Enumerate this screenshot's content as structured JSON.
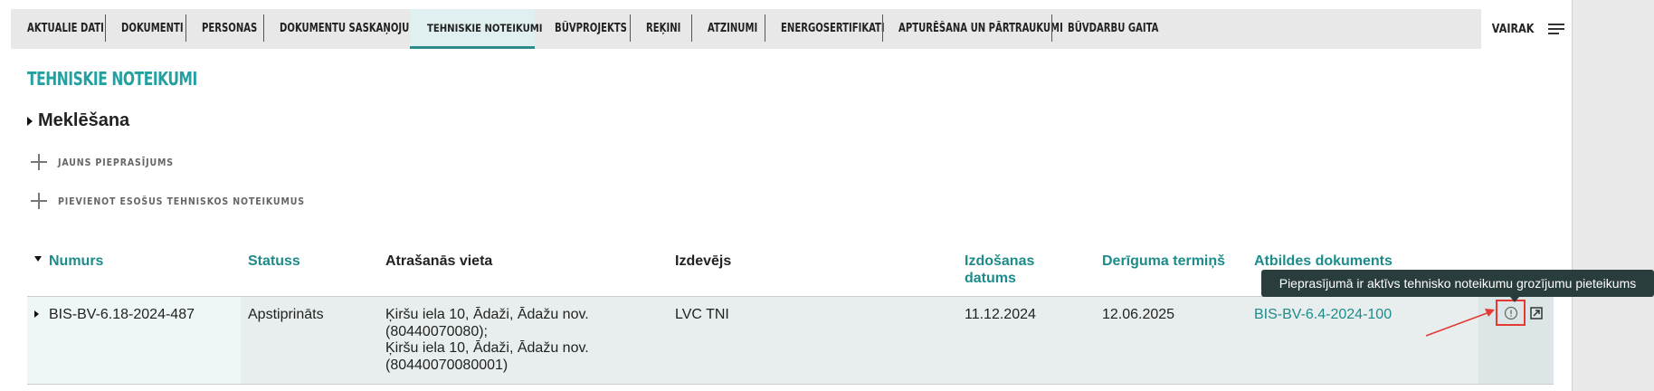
{
  "tabs": [
    {
      "label": "AKTUĀLIE DATI"
    },
    {
      "label": "DOKUMENTI"
    },
    {
      "label": "PERSONAS"
    },
    {
      "label": "DOKUMENTU SASKAŅOJUMI"
    },
    {
      "label": "TEHNISKIE NOTEIKUMI",
      "active": true
    },
    {
      "label": "BŪVPROJEKTS"
    },
    {
      "label": "RĒĶINI"
    },
    {
      "label": "ATZINUMI"
    },
    {
      "label": "ENERGOSERTIFIKĀTI"
    },
    {
      "label": "APTURĒŠANA UN PĀRTRAUKUMI"
    },
    {
      "label": "BŪVDARBU GAITA"
    }
  ],
  "more_label": "VAIRĀK",
  "page_title": "TEHNISKIE NOTEIKUMI",
  "search_label": "Meklēšana",
  "actions": {
    "new_request": "JAUNS PIEPRASĪJUMS",
    "add_existing": "PIEVIENOT ESOŠUS TEHNISKOS NOTEIKUMUS"
  },
  "table": {
    "headers": {
      "number": "Numurs",
      "status": "Statuss",
      "location": "Atrašanās vieta",
      "issuer": "Izdevējs",
      "issue_date_1": "Izdošanas",
      "issue_date_2": "datums",
      "validity": "Derīguma termiņš",
      "response_doc": "Atbildes dokuments"
    },
    "rows": [
      {
        "number": "BIS-BV-6.18-2024-487",
        "status": "Apstiprināts",
        "location_1": "Ķiršu iela 10, Ādaži, Ādažu nov.",
        "location_2": "(80440070080);",
        "location_3": "Ķiršu iela 10, Ādaži, Ādažu nov.",
        "location_4": "(80440070080001)",
        "issuer": "LVC TNI",
        "issue_date": "11.12.2024",
        "validity": "12.06.2025",
        "response_doc": "BIS-BV-6.4-2024-100"
      }
    ]
  },
  "tooltip": "Pieprasījumā ir aktīvs tehnisko noteikumu grozījumu pieteikums",
  "icons": {
    "info": "info-icon",
    "external": "external-link-icon",
    "menu": "hamburger-icon"
  },
  "colors": {
    "accent": "#1e8b8b",
    "tooltip_bg": "#2a3d3d",
    "highlight": "#e53935"
  }
}
